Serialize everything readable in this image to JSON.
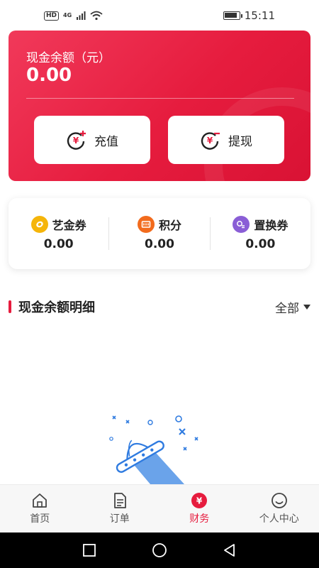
{
  "status_bar": {
    "left_badges": [
      "HD",
      "4G"
    ],
    "time": "15:11"
  },
  "balance": {
    "title": "现金余额（元）",
    "amount": "0.00",
    "recharge_label": "充值",
    "withdraw_label": "提现"
  },
  "points": [
    {
      "label": "艺金券",
      "value": "0.00",
      "icon": "coin-icon",
      "color": "#f5b50a"
    },
    {
      "label": "积分",
      "value": "0.00",
      "icon": "points-icon",
      "color": "#f26b1d"
    },
    {
      "label": "置换券",
      "value": "0.00",
      "icon": "voucher-icon",
      "color": "#8a5ed6"
    }
  ],
  "section": {
    "title": "现金余额明细",
    "filter_label": "全部"
  },
  "tabbar": {
    "items": [
      {
        "label": "首页",
        "icon": "home-icon",
        "active": false
      },
      {
        "label": "订单",
        "icon": "order-icon",
        "active": false
      },
      {
        "label": "财务",
        "icon": "finance-icon",
        "active": true
      },
      {
        "label": "个人中心",
        "icon": "profile-icon",
        "active": false
      }
    ]
  },
  "colors": {
    "accent": "#e61c3e",
    "card_gradient_start": "#f1395a",
    "card_gradient_end": "#d91234"
  }
}
